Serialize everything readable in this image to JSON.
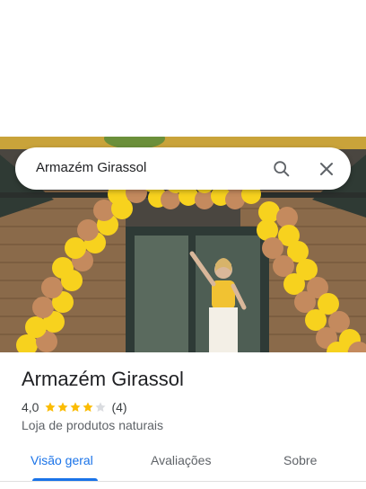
{
  "search": {
    "query": "Armazém Girassol"
  },
  "photo": {
    "alt": "Armazém Girassol"
  },
  "place": {
    "name": "Armazém Girassol",
    "rating": "4,0",
    "rating_stars": 4,
    "review_count": "(4)",
    "category": "Loja de produtos naturais"
  },
  "tabs": [
    {
      "label": "Visão geral",
      "active": true
    },
    {
      "label": "Avaliações",
      "active": false
    },
    {
      "label": "Sobre",
      "active": false
    }
  ],
  "colors": {
    "accent": "#1a73e8",
    "star": "#fbbc04",
    "star_empty": "#dadce0"
  },
  "icons": {
    "search": "search-icon",
    "close": "close-icon"
  }
}
